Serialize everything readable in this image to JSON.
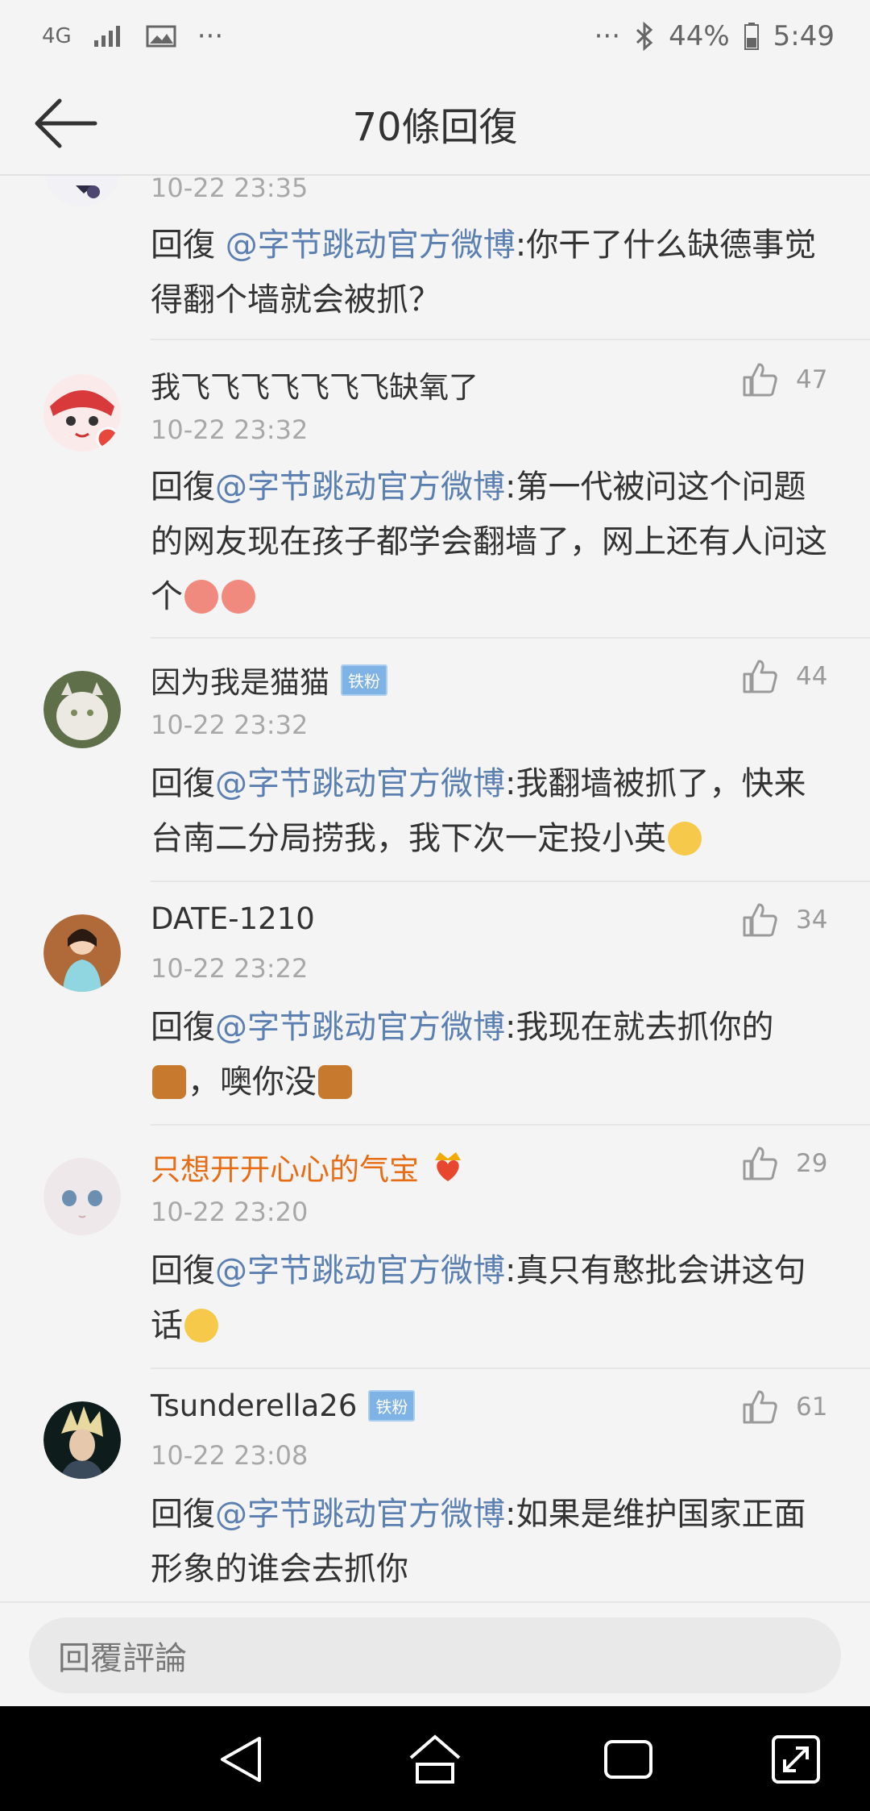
{
  "status": {
    "network": "4G",
    "battery": "44%",
    "time": "5:49",
    "dots": "···"
  },
  "header": {
    "title": "70條回復"
  },
  "top_partial": {
    "time": "10-22 23:35",
    "prefix": "回復 ",
    "mention": "@字节跳动官方微博",
    "text": ":你干了什么缺德事觉得翻个墙就会被抓？"
  },
  "comments": [
    {
      "name": "我飞飞飞飞飞飞飞缺氧了",
      "time": "10-22 23:32",
      "likes": "47",
      "prefix": "回復",
      "mention": "@字节跳动官方微博",
      "text": ":第一代被问这个问题的网友现在孩子都学会翻墙了，网上还有人问这个"
    },
    {
      "name": "因为我是猫猫",
      "badge": "铁粉",
      "time": "10-22 23:32",
      "likes": "44",
      "prefix": "回復",
      "mention": "@字节跳动官方微博",
      "text": ":我翻墙被抓了，快来台南二分局捞我，我下次一定投小英"
    },
    {
      "name": "DATE-1210",
      "time": "10-22 23:22",
      "likes": "34",
      "prefix": "回復",
      "mention": "@字节跳动官方微博",
      "text": ":我现在就去抓你的",
      "text2": "，噢你没"
    },
    {
      "name": "只想开开心心的气宝",
      "time": "10-22 23:20",
      "likes": "29",
      "prefix": "回復",
      "mention": "@字节跳动官方微博",
      "text": ":真只有憨批会讲这句话"
    },
    {
      "name": "Tsunderella26",
      "badge": "铁粉",
      "time": "10-22 23:08",
      "likes": "61",
      "prefix": "回復",
      "mention": "@字节跳动官方微博",
      "text": ":如果是维护国家正面形象的谁会去抓你"
    }
  ],
  "reply": {
    "placeholder": "回覆評論"
  },
  "colors": {
    "mention": "#5b7fb0",
    "vip_name": "#e86c13",
    "badge": "#7fb2e5"
  }
}
